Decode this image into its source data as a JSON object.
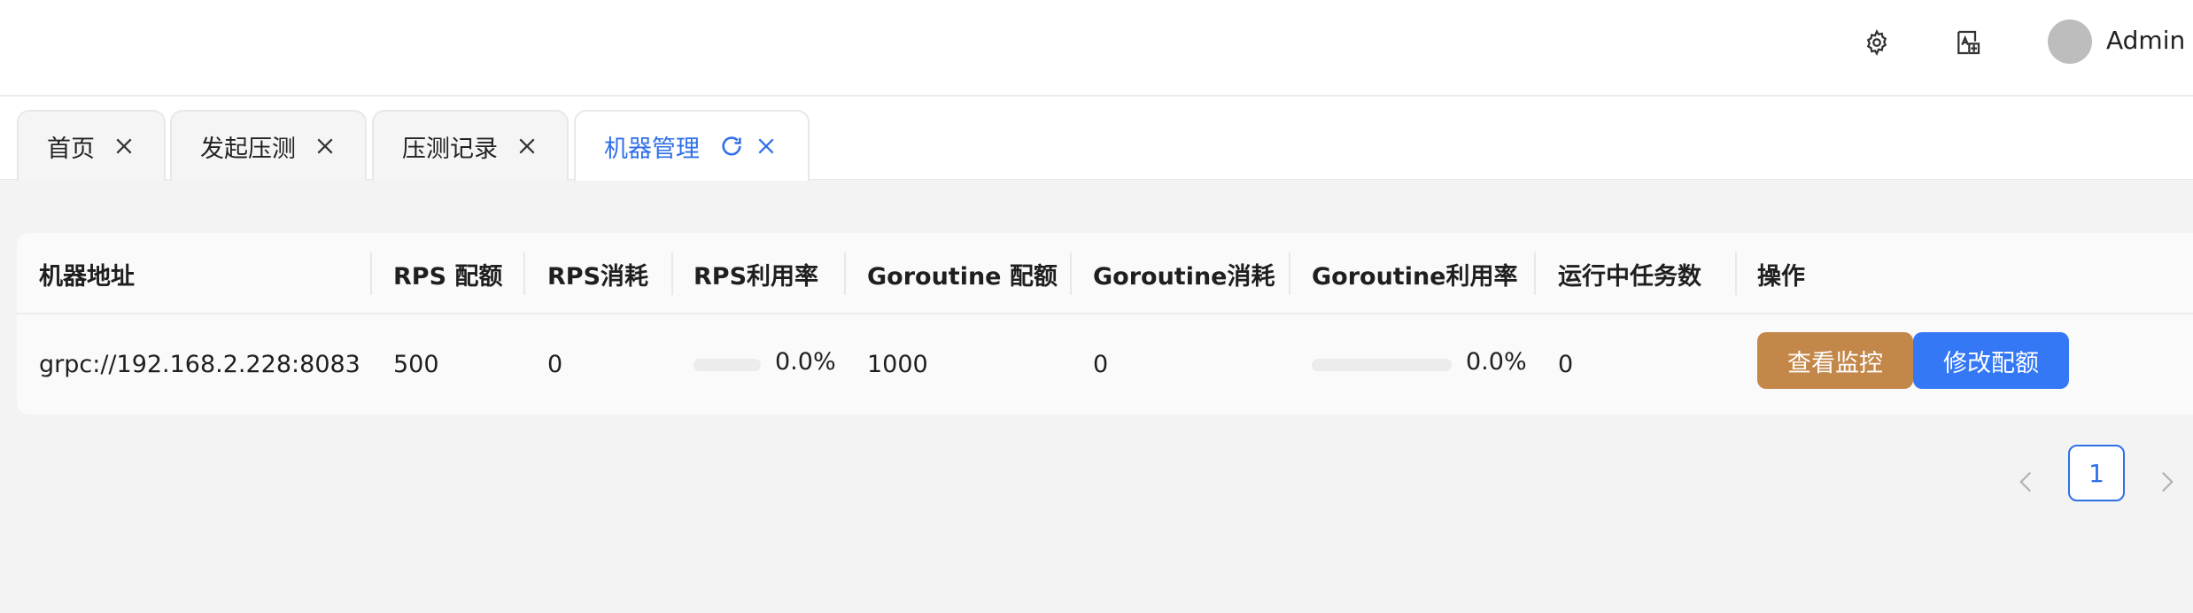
{
  "header": {
    "user_name": "Admin",
    "icons": [
      "gear-icon",
      "translate-icon",
      "avatar"
    ]
  },
  "tabs": [
    {
      "label": "首页",
      "active": false
    },
    {
      "label": "发起压测",
      "active": false
    },
    {
      "label": "压测记录",
      "active": false
    },
    {
      "label": "机器管理",
      "active": true
    }
  ],
  "table": {
    "columns": [
      "机器地址",
      "RPS 配额",
      "RPS消耗",
      "RPS利用率",
      "Goroutine 配额",
      "Goroutine消耗",
      "Goroutine利用率",
      "运行中任务数",
      "操作"
    ],
    "rows": [
      {
        "address": "grpc://192.168.2.228:8083",
        "rps_quota": "500",
        "rps_used": "0",
        "rps_util_text": "0.0%",
        "rps_util": 0.0,
        "goroutine_quota": "1000",
        "goroutine_used": "0",
        "goroutine_util_text": "0.0%",
        "goroutine_util": 0.0,
        "running_tasks": "0",
        "actions": {
          "monitor": "查看监控",
          "quota": "修改配额"
        }
      }
    ]
  },
  "pagination": {
    "current": "1"
  },
  "colors": {
    "accent": "#2f6fe8",
    "monitor_btn": "#c4874a",
    "quota_btn": "#3478f6"
  }
}
